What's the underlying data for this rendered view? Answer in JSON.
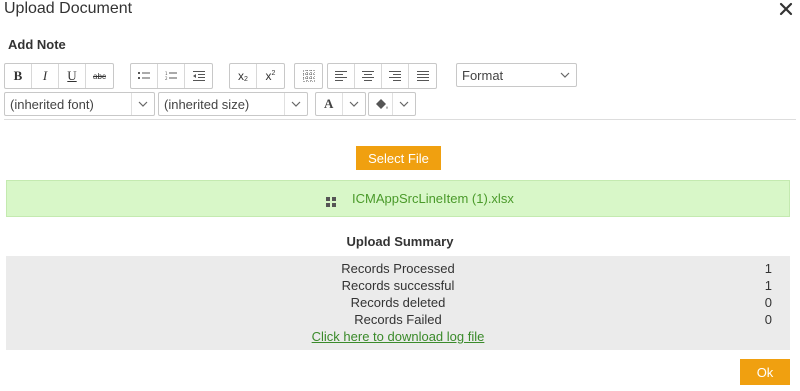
{
  "dialog": {
    "title": "Upload Document",
    "note_label": "Add Note"
  },
  "editor": {
    "toolbar": {
      "bold": "B",
      "italic": "I",
      "underline": "U",
      "strike": "abc",
      "subscript": "x",
      "superscript": "x",
      "format_placeholder": "Format",
      "font_value": "(inherited font)",
      "size_value": "(inherited size)",
      "font_color": "A"
    }
  },
  "upload": {
    "select_button": "Select File",
    "file_name": "ICMAppSrcLineItem (1).xlsx"
  },
  "summary": {
    "title": "Upload Summary",
    "rows": [
      {
        "label": "Records Processed",
        "value": "1"
      },
      {
        "label": "Records successful",
        "value": "1"
      },
      {
        "label": "Records deleted",
        "value": "0"
      },
      {
        "label": "Records Failed",
        "value": "0"
      }
    ],
    "log_link": "Click here to download log file"
  },
  "footer": {
    "ok_button": "Ok"
  },
  "colors": {
    "accent": "#f0a010",
    "file_bar": "#d8f7c8",
    "file_text": "#4a9a2a",
    "summary_bg": "#ebebeb"
  },
  "icons": [
    "close-icon",
    "bullet-list-icon",
    "numbered-list-icon",
    "outdent-icon",
    "table-icon",
    "align-left-icon",
    "align-center-icon",
    "align-right-icon",
    "align-justify-icon",
    "chevron-down-icon",
    "paint-bucket-icon",
    "file-icon"
  ]
}
